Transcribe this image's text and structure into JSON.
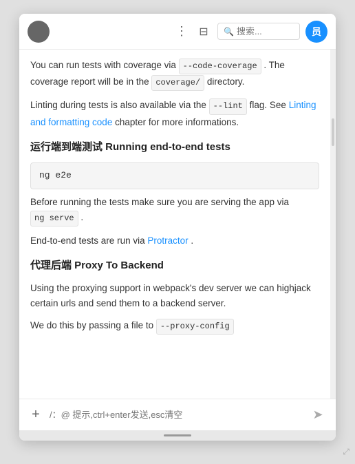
{
  "header": {
    "more_icon": "⋮",
    "layout_icon": "⊟",
    "search_placeholder": "搜索...",
    "user_initial": "员"
  },
  "content": {
    "para1_before": "You can run tests with coverage via ",
    "code1": "--code-coverage",
    "para1_mid": ". The coverage report will be in the ",
    "code2": "coverage/",
    "para1_after": " directory.",
    "para2_before": "Linting during tests is also available via the ",
    "code3": "--lint",
    "para2_mid": " flag. See ",
    "link1": "Linting and formatting code",
    "para2_after": " chapter for more informations.",
    "section1": "运行端到端测试 Running end-to-end tests",
    "code_block1": "ng e2e",
    "para3": "Before running the tests make sure you are serving the app via ",
    "code4": "ng serve",
    "para3_after": ".",
    "para4_before": "End-to-end tests are run via ",
    "link2": "Protractor",
    "para4_after": ".",
    "section2": "代理后端 Proxy To Backend",
    "para5": "Using the proxying support in webpack's dev server we can highjack certain urls and send them to a backend server.",
    "para6_before": "We do this by passing a file to ",
    "code5": "--proxy-config",
    "coverage_detected": "coverage"
  },
  "input_bar": {
    "add_label": "+",
    "placeholder": "/：@ 提示,ctrl+enter发送,esc清空",
    "send_icon": "➤"
  }
}
